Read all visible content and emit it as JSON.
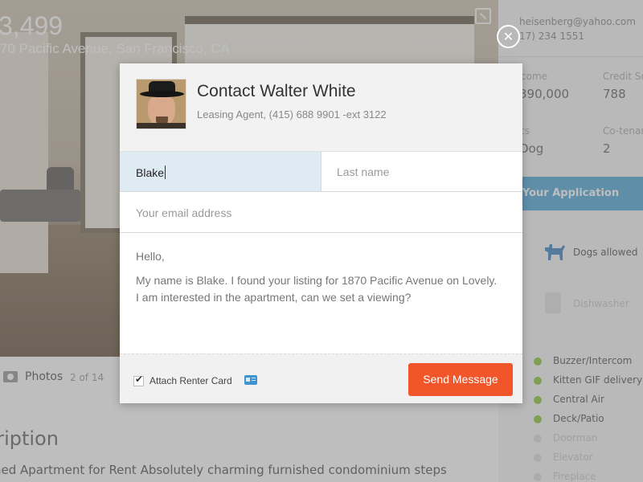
{
  "listing": {
    "price": "3,499",
    "address": "70 Pacific Avenue, San Francisco, CA",
    "photos_label": "Photos",
    "photos_count": "2 of 14",
    "description_title": "cription",
    "description_text": "hed Apartment for Rent Absolutely charming furnished condominium steps"
  },
  "sidebar": {
    "email": "heisenberg@yahoo.com",
    "phone": "17) 234 1551",
    "income_label": "come",
    "income_value": "390,000",
    "credit_label": "Credit Sc",
    "credit_value": "788",
    "pets_label": "ts",
    "pets_value": "Dog",
    "cotenants_label": "Co-tenan",
    "cotenants_value": "2",
    "application_button": "Your Application",
    "features": [
      {
        "label": "Dogs allowed",
        "icon": "dog-icon"
      },
      {
        "label": "Dishwasher",
        "icon": "dishwasher-icon"
      }
    ],
    "amenities": [
      {
        "label": "Buzzer/Intercom",
        "available": true
      },
      {
        "label": "Kitten GIF delivery",
        "available": true
      },
      {
        "label": "Central Air",
        "available": true
      },
      {
        "label": "Deck/Patio",
        "available": true
      },
      {
        "label": "Doorman",
        "available": false
      },
      {
        "label": "Elevator",
        "available": false
      },
      {
        "label": "Fireplace",
        "available": false
      }
    ]
  },
  "modal": {
    "title": "Contact Walter White",
    "subtitle": "Leasing Agent, (415) 688 9901 -ext 3122",
    "close_icon": "close-icon",
    "first_name_value": "Blake",
    "last_name_placeholder": "Last name",
    "email_placeholder": "Your email address",
    "message_greeting": "Hello,",
    "message_body_line1": "My name is Blake. I found your listing for 1870 Pacific Avenue on Lovely.",
    "message_body_line2": "I am interested in the apartment, can we set a viewing?",
    "attach_label": "Attach Renter Card",
    "attach_checked": true,
    "send_button": "Send Message",
    "accent_color": "#f0562a"
  }
}
